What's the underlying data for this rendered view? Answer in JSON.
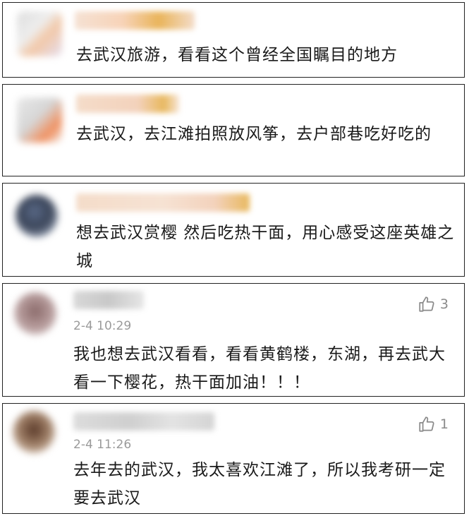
{
  "comments": [
    {
      "text": "去武汉旅游，看看这个曾经全国瞩目的地方"
    },
    {
      "text": "去武汉，去江滩拍照放风筝，去户部巷吃好吃的"
    },
    {
      "text": "想去武汉赏樱 然后吃热干面，用心感受这座英雄之城"
    },
    {
      "text": "我也想去武汉看看，看看黄鹤楼，东湖，再去武大看一下樱花，热干面加油！！！",
      "time": "2-4 10:29",
      "likes": "3"
    },
    {
      "text": "去年去的武汉，我太喜欢江滩了，所以我考研一定要去武汉",
      "time": "2-4 11:26",
      "likes": "1"
    }
  ],
  "icons": {
    "like": "thumbs-up-icon"
  },
  "colors": {
    "time": "#9a9a9a",
    "like": "#8a8a8a",
    "border": "#222222"
  }
}
